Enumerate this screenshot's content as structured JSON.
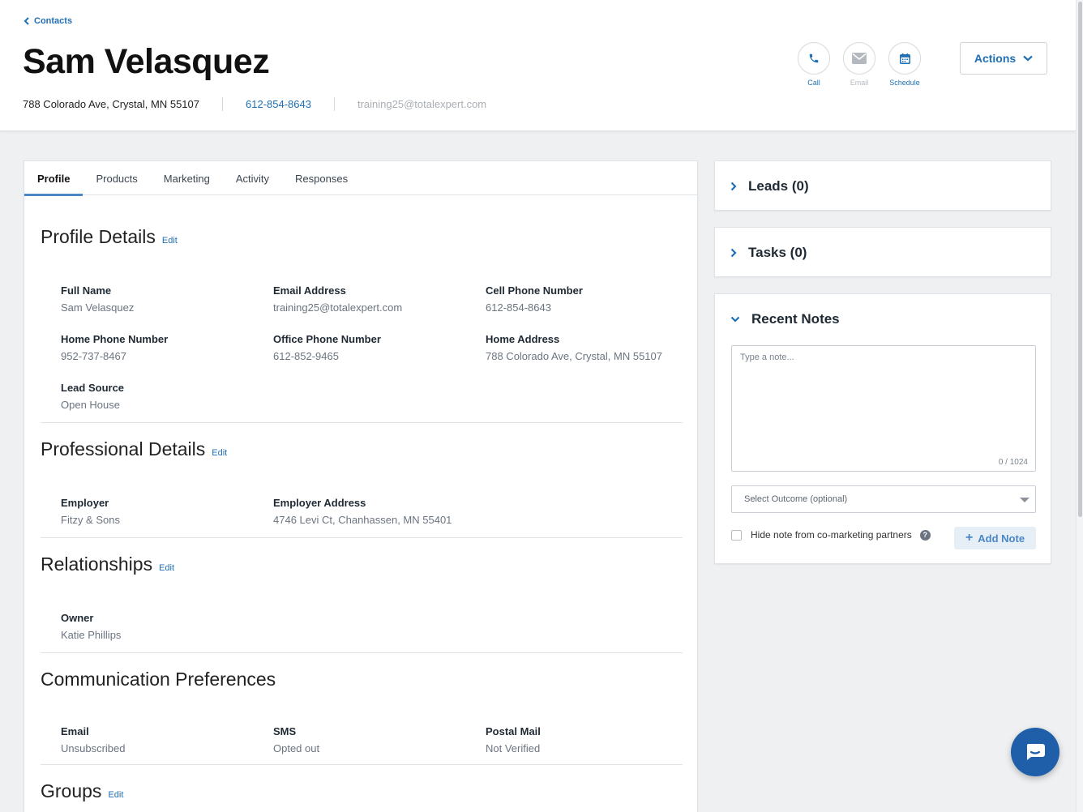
{
  "header": {
    "back_label": "Contacts",
    "name": "Sam Velasquez",
    "address": "788 Colorado Ave, Crystal, MN 55107",
    "phone": "612-854-8643",
    "email": "training25@totalexpert.com",
    "quick_actions": {
      "call": "Call",
      "email": "Email",
      "schedule": "Schedule"
    },
    "actions_label": "Actions"
  },
  "tabs": [
    "Profile",
    "Products",
    "Marketing",
    "Activity",
    "Responses"
  ],
  "edit_label": "Edit",
  "profile_details": {
    "title": "Profile Details",
    "fields": [
      {
        "label": "Full Name",
        "value": "Sam Velasquez"
      },
      {
        "label": "Email Address",
        "value": "training25@totalexpert.com"
      },
      {
        "label": "Cell Phone Number",
        "value": "612-854-8643"
      },
      {
        "label": "Home Phone Number",
        "value": "952-737-8467"
      },
      {
        "label": "Office Phone Number",
        "value": "612-852-9465"
      },
      {
        "label": "Home Address",
        "value": "788 Colorado Ave, Crystal, MN 55107"
      },
      {
        "label": "Lead Source",
        "value": "Open House"
      }
    ]
  },
  "professional_details": {
    "title": "Professional Details",
    "fields": [
      {
        "label": "Employer",
        "value": "Fitzy & Sons"
      },
      {
        "label": "Employer Address",
        "value": "4746 Levi Ct, Chanhassen, MN 55401"
      }
    ]
  },
  "relationships": {
    "title": "Relationships",
    "fields": [
      {
        "label": "Owner",
        "value": "Katie Phillips"
      }
    ]
  },
  "communication": {
    "title": "Communication Preferences",
    "fields": [
      {
        "label": "Email",
        "value": "Unsubscribed"
      },
      {
        "label": "SMS",
        "value": "Opted out"
      },
      {
        "label": "Postal Mail",
        "value": "Not Verified"
      }
    ]
  },
  "groups": {
    "title": "Groups"
  },
  "leads": {
    "title": "Leads (0)"
  },
  "tasks": {
    "title": "Tasks (0)"
  },
  "notes": {
    "title": "Recent Notes",
    "placeholder": "Type a note...",
    "counter": "0 / 1024",
    "outcome_placeholder": "Select Outcome (optional)",
    "hide_label": "Hide note from co-marketing partners",
    "add_label": "Add Note"
  },
  "colors": {
    "accent": "#1f6fb5",
    "tab_underline": "#4b86c5",
    "chat_button": "#1f5ea8"
  }
}
